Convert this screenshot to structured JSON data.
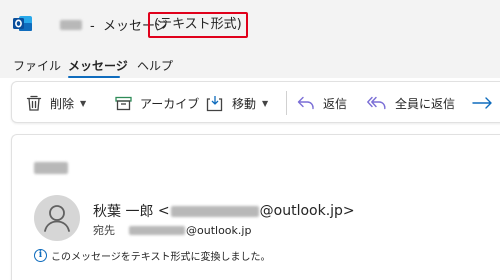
{
  "titlebar": {
    "separator": "-",
    "window_title": "メッセージ",
    "format_label": "(テキスト形式)"
  },
  "menu": {
    "items": [
      "ファイル",
      "メッセージ",
      "ヘルプ"
    ],
    "active": "メッセージ"
  },
  "ribbon": {
    "delete": "削除",
    "archive": "アーカイブ",
    "move": "移動",
    "reply": "返信",
    "reply_all": "全員に返信"
  },
  "message": {
    "sender_name": "秋葉 一郎",
    "sender_open": "<",
    "sender_domain": "@outlook.jp>",
    "to_label": "宛先",
    "to_domain": "@outlook.jp",
    "info_text": "このメッセージをテキスト形式に変換しました。"
  },
  "colors": {
    "accent": "#0f6cbd",
    "highlight_border": "#e0001b",
    "chrome_bg": "#f3f3f3",
    "reply_icon": "#7b6fd6",
    "archive_icon": "#2e8b57"
  },
  "icons": [
    "outlook-app-icon",
    "trash-icon",
    "archive-icon",
    "move-icon",
    "reply-icon",
    "reply-all-icon",
    "forward-icon",
    "person-icon",
    "info-icon"
  ]
}
